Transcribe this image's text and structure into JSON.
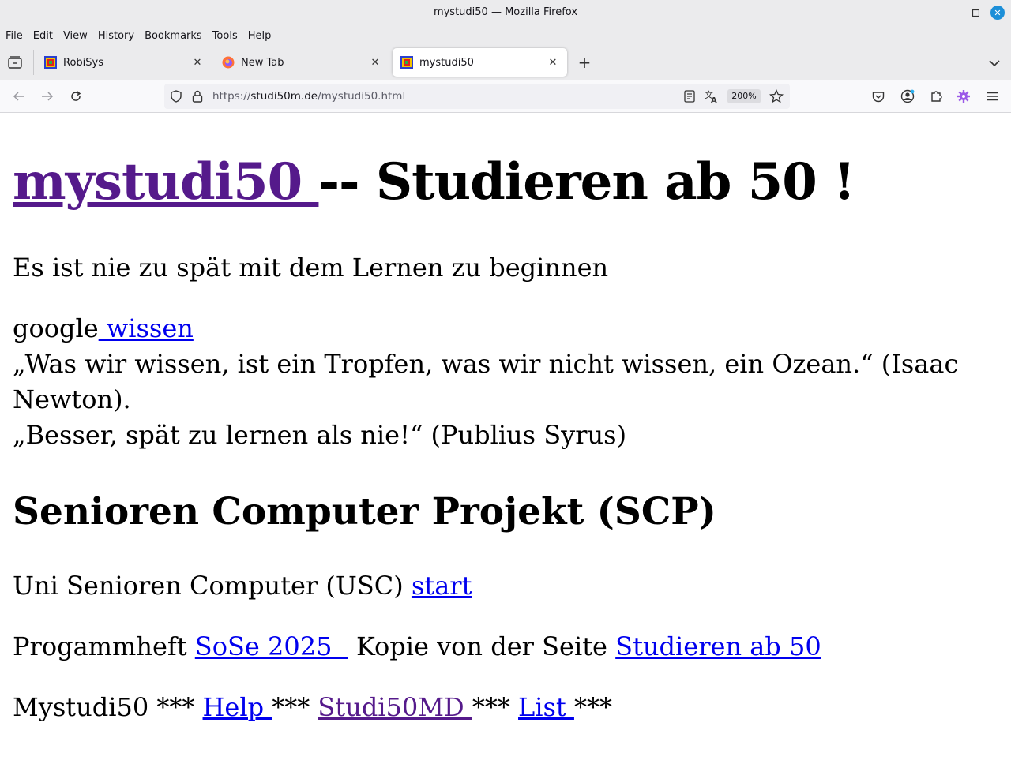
{
  "window": {
    "title": "mystudi50 — Mozilla Firefox"
  },
  "menu": {
    "file": "File",
    "edit": "Edit",
    "view": "View",
    "history": "History",
    "bookmarks": "Bookmarks",
    "tools": "Tools",
    "help": "Help"
  },
  "tabs": [
    {
      "label": "RobiSys",
      "icon": "robisys-favicon"
    },
    {
      "label": "New Tab",
      "icon": "firefox-favicon"
    },
    {
      "label": "mystudi50",
      "icon": "robisys-favicon",
      "active": true
    }
  ],
  "urlbar": {
    "scheme": "https://",
    "host": "studi50m.de",
    "path": "/mystudi50.html",
    "zoom": "200%"
  },
  "page": {
    "h1_link": "mystudi50 ",
    "h1_rest": "-- Studieren ab 50 !",
    "tagline": "Es ist nie zu spät mit dem Lernen zu beginnen",
    "google_prefix": "google",
    "google_link": " wissen",
    "quote1_line1": "„Was wir wissen, ist ein Tropfen, was wir nicht wissen, ein Ozean.“ (Isaac",
    "quote1_line2": "Newton).",
    "quote2": "„Besser, spät zu lernen als nie!“ (Publius Syrus)",
    "h2": "Senioren Computer Projekt (SCP)",
    "usc_text": "Uni Senioren Computer (USC) ",
    "usc_link": "start",
    "prog_text": "Progammheft ",
    "prog_link": "SoSe 2025  ",
    "copy_text": " Kopie von der Seite ",
    "copy_link": "Studieren ab 50",
    "my_text": "Mystudi50 *** ",
    "help_link": "Help ",
    "sep1": "*** ",
    "studi_link": "Studi50MD ",
    "sep2": "*** ",
    "list_link": "List ",
    "sep3": "***"
  },
  "colors": {
    "link": "#0000ee",
    "visited": "#551a8b",
    "chrome": "#ebebed",
    "close_button": "#1c8fd8"
  }
}
